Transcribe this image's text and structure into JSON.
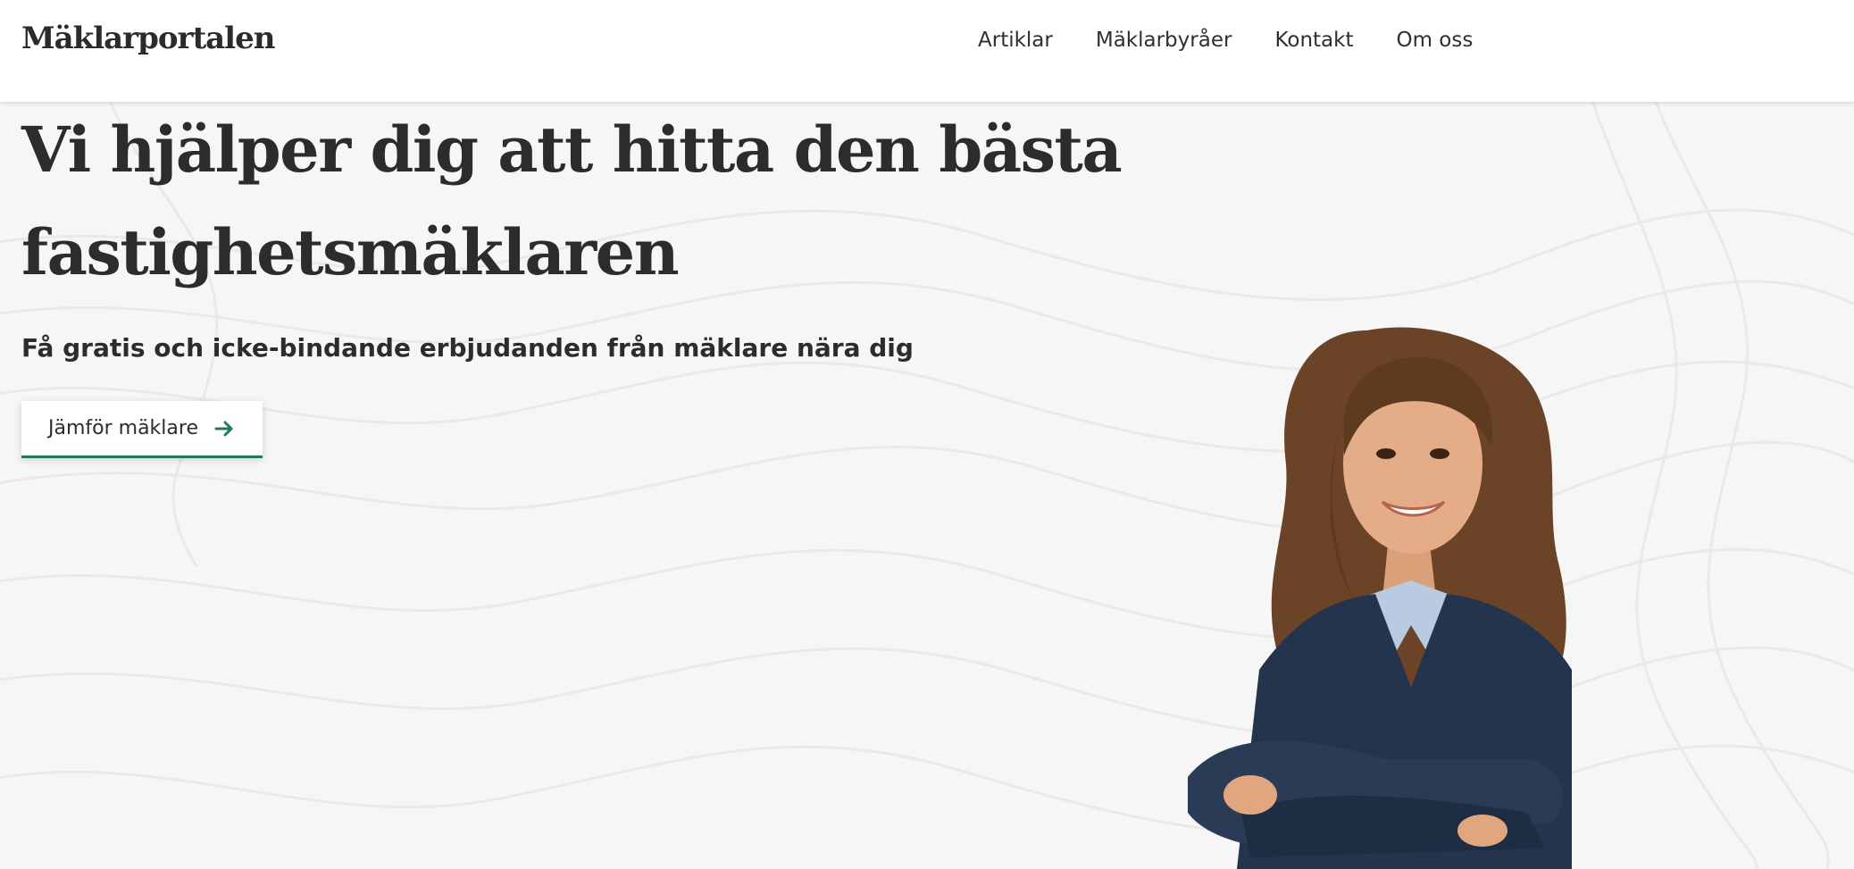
{
  "header": {
    "logo": "Mäklarportalen",
    "nav": [
      {
        "label": "Artiklar"
      },
      {
        "label": "Mäklarbyråer"
      },
      {
        "label": "Kontakt"
      },
      {
        "label": "Om oss"
      }
    ]
  },
  "hero": {
    "title_line1": "Vi hjälper dig att hitta den bästa",
    "title_line2": "fastighetsmäklaren",
    "subtitle": "Få gratis och icke-bindande erbjudanden från mäklare nära dig",
    "cta_label": "Jämför mäklare",
    "cta_icon": "arrow-right-icon"
  },
  "colors": {
    "accent": "#1f7a57",
    "background": "#f6f6f6",
    "header_bg": "#ffffff",
    "text": "#2c2c2c"
  }
}
